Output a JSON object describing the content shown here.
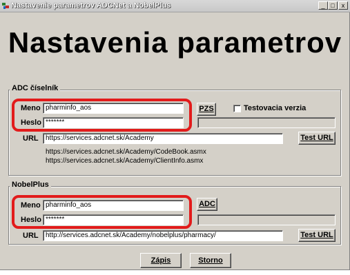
{
  "window": {
    "title": "Nastavenie parametrov ADCNet a NobelPlus",
    "minimize_glyph": "_",
    "maximize_glyph": "□",
    "close_glyph": "x"
  },
  "heading": "Nastavenia parametrov",
  "adc": {
    "group_label": "ADC číselník",
    "meno_label": "Meno",
    "meno_value": "pharminfo_aos",
    "heslo_label": "Heslo",
    "heslo_value": "*******",
    "url_label": "URL",
    "url_value": "https://services.adcnet.sk/Academy",
    "pzs_button": "PZS",
    "test_checkbox_label": "Testovacia verzia",
    "test_checkbox_checked": false,
    "test_url_button": "Test URL",
    "info_urls": [
      "https://services.adcnet.sk/Academy/CodeBook.asmx",
      "https://services.adcnet.sk/Academy/ClientInfo.asmx"
    ]
  },
  "nobel": {
    "group_label": "NobelPlus",
    "meno_label": "Meno",
    "meno_value": "pharminfo_aos",
    "heslo_label": "Heslo",
    "heslo_value": "*******",
    "url_label": "URL",
    "url_value": "http://services.adcnet.sk/Academy/nobelplus/pharmacy/",
    "adc_button": "ADC",
    "test_url_button": "Test URL"
  },
  "footer": {
    "save_button": "Zápis",
    "cancel_button": "Storno"
  },
  "colors": {
    "dialog_bg": "#d4d0c8",
    "highlight": "#e21b1b"
  }
}
